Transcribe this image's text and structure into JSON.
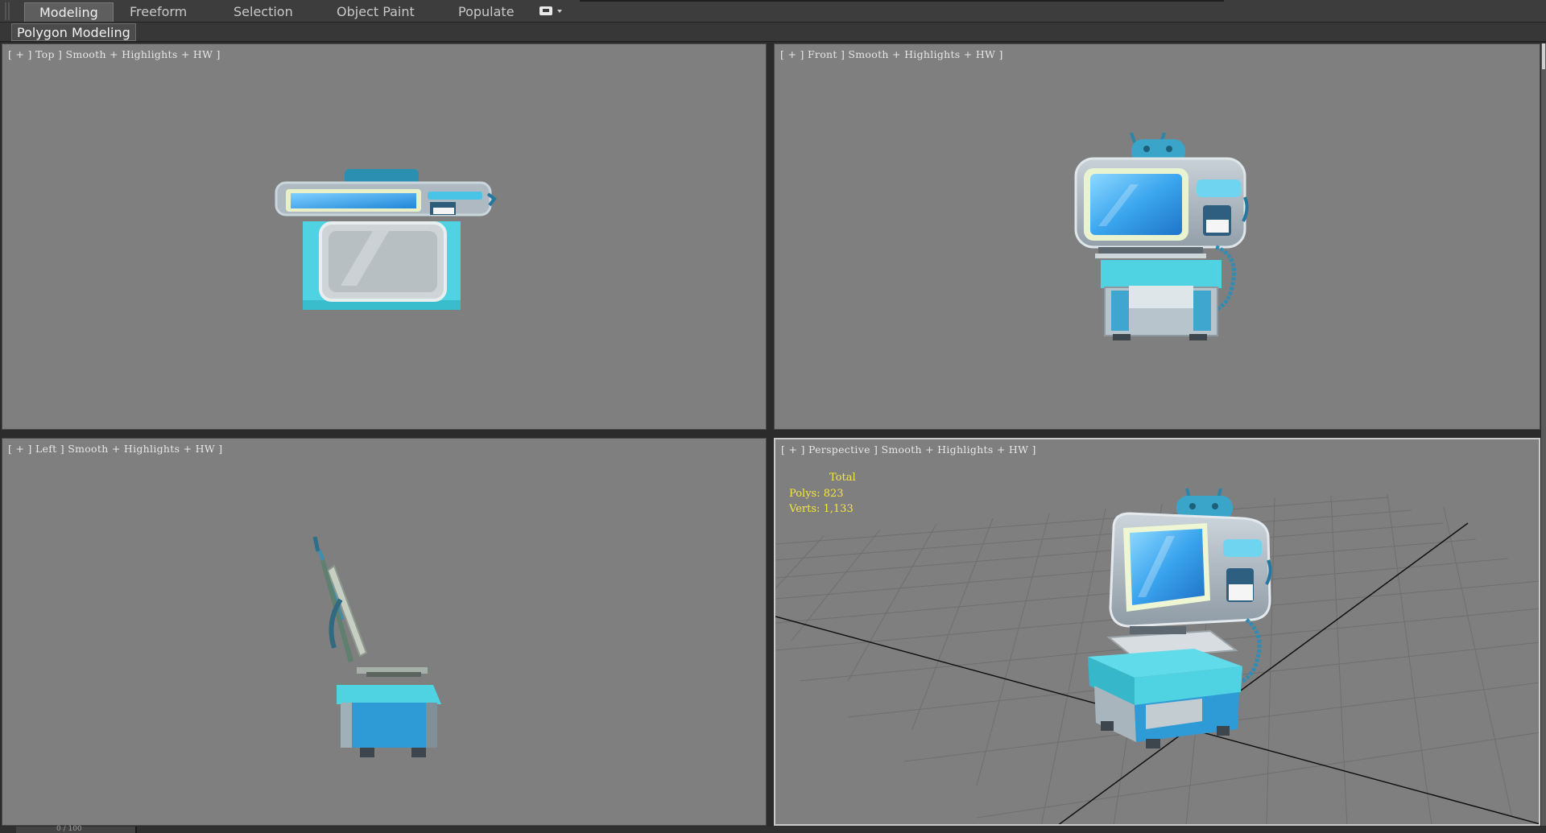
{
  "ribbon": {
    "tabs": [
      {
        "label": "Modeling",
        "active": true
      },
      {
        "label": "Freeform",
        "active": false
      },
      {
        "label": "Selection",
        "active": false
      },
      {
        "label": "Object Paint",
        "active": false
      },
      {
        "label": "Populate",
        "active": false
      }
    ],
    "options_icon": "menu-dropdown-icon",
    "subtab": "Polygon Modeling"
  },
  "viewports": {
    "top": {
      "label": "[ + ] Top ] Smooth + Highlights + HW ]"
    },
    "front": {
      "label": "[ + ] Front ] Smooth + Highlights + HW ]"
    },
    "left": {
      "label": "[ + ] Left ] Smooth + Highlights + HW ]"
    },
    "perspective": {
      "label": "[ + ] Perspective ] Smooth + Highlights + HW ]",
      "stats": {
        "title": "Total",
        "polys": "Polys: 823",
        "verts": "Verts: 1,133"
      }
    }
  },
  "status": {
    "text": "0 / 100"
  },
  "colors": {
    "viewport_bg": "#7f7f7f",
    "model_teal": "#3fc4d6",
    "model_screen": "#38a8e8",
    "model_body": "#a9b3bd",
    "stats_yellow": "#f5e642"
  }
}
